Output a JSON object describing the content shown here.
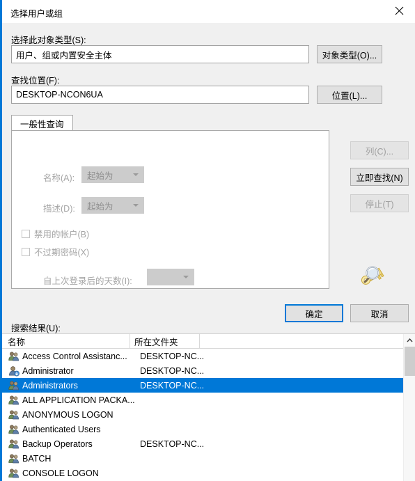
{
  "window": {
    "title": "选择用户或组",
    "close_icon": "close-icon",
    "accent_color": "#0078d7",
    "background_color": "#f0f0f0"
  },
  "object_type": {
    "label": "选择此对象类型(S):",
    "value": "用户、组或内置安全主体",
    "button_label": "对象类型(O)..."
  },
  "location": {
    "label": "查找位置(F):",
    "value": "DESKTOP-NCON6UA",
    "button_label": "位置(L)..."
  },
  "tabs": [
    {
      "label": "一般性查询",
      "active": true
    }
  ],
  "query_panel": {
    "name_label": "名称(A):",
    "name_condition": "起始为",
    "description_label": "描述(D):",
    "description_condition": "起始为",
    "disabled_accounts_label": "禁用的帐户(B)",
    "non_expiring_password_label": "不过期密码(X)",
    "days_since_logon_label": "自上次登录后的天数(I):",
    "days_since_logon_value": ""
  },
  "side_buttons": [
    {
      "label": "列(C)...",
      "enabled": false,
      "name": "columns-button"
    },
    {
      "label": "立即查找(N)",
      "enabled": true,
      "name": "find-now-button"
    },
    {
      "label": "停止(T)",
      "enabled": false,
      "name": "stop-button"
    }
  ],
  "key_icon": "search-key-icon",
  "dialog_buttons": {
    "ok_label": "确定",
    "cancel_label": "取消"
  },
  "results": {
    "label": "搜索结果(U):",
    "columns": [
      "名称",
      "所在文件夹"
    ],
    "rows": [
      {
        "icon": "group-icon",
        "name": "Access Control Assistanc...",
        "folder": "DESKTOP-NC...",
        "selected": false
      },
      {
        "icon": "user-icon",
        "name": "Administrator",
        "folder": "DESKTOP-NC...",
        "selected": false
      },
      {
        "icon": "group-icon",
        "name": "Administrators",
        "folder": "DESKTOP-NC...",
        "selected": true
      },
      {
        "icon": "group-icon",
        "name": "ALL APPLICATION PACKA...",
        "folder": "",
        "selected": false
      },
      {
        "icon": "group-icon",
        "name": "ANONYMOUS LOGON",
        "folder": "",
        "selected": false
      },
      {
        "icon": "group-icon",
        "name": "Authenticated Users",
        "folder": "",
        "selected": false
      },
      {
        "icon": "group-icon",
        "name": "Backup Operators",
        "folder": "DESKTOP-NC...",
        "selected": false
      },
      {
        "icon": "group-icon",
        "name": "BATCH",
        "folder": "",
        "selected": false
      },
      {
        "icon": "group-icon",
        "name": "CONSOLE LOGON",
        "folder": "",
        "selected": false
      }
    ],
    "scrollbar": {
      "up_icon": "chevron-up-icon"
    }
  }
}
